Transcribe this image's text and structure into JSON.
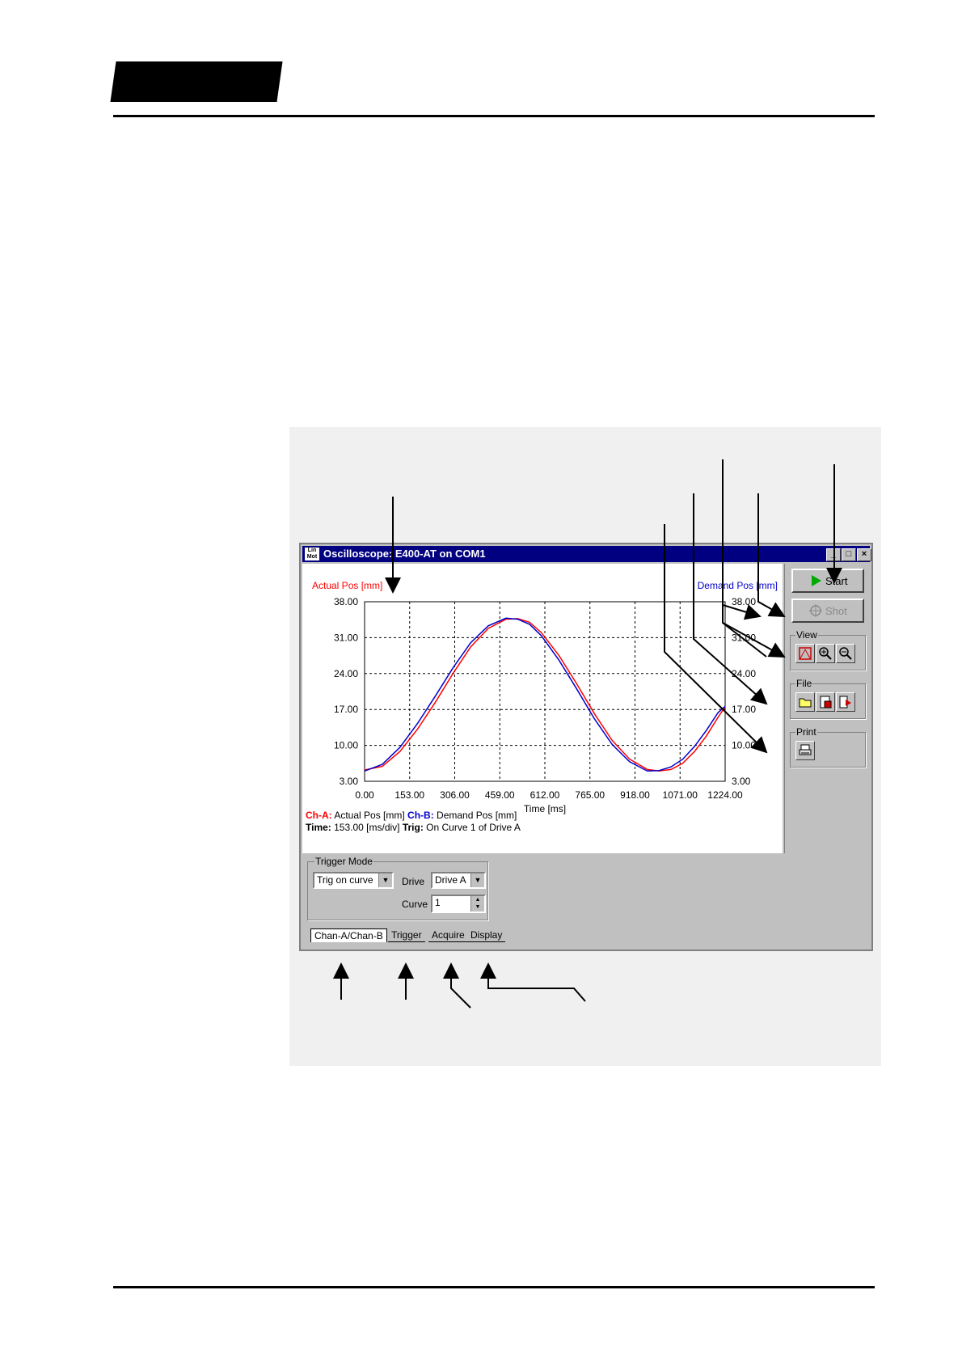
{
  "window": {
    "title": "Oscilloscope: E400-AT on COM1",
    "app_icon_line1": "Lin",
    "app_icon_line2": "Mot",
    "minimize_glyph": "_",
    "maximize_glyph": "□",
    "close_glyph": "×"
  },
  "side_panel": {
    "start_label": "Start",
    "shot_label": "Shot",
    "view_label": "View",
    "file_label": "File",
    "print_label": "Print"
  },
  "info": {
    "cha_label": "Ch-A:",
    "cha_value": "Actual Pos [mm]",
    "chb_label": "Ch-B:",
    "chb_value": "Demand Pos [mm]",
    "time_label": "Time:",
    "time_value": "153.00 [ms/div]",
    "trig_label": "Trig:",
    "trig_value": "On Curve 1 of Drive A"
  },
  "trigger": {
    "group_label": "Trigger Mode",
    "mode_value": "Trig on curve",
    "drive_label": "Drive",
    "drive_value": "Drive A",
    "curve_label": "Curve",
    "curve_value": "1"
  },
  "tabs": [
    "Chan-A/Chan-B",
    "Trigger",
    "Acquire",
    "Display"
  ],
  "colors": {
    "channel_a": "#ff0000",
    "channel_b": "#0000cc",
    "title_bar": "#000080",
    "start_icon": "#00aa00"
  },
  "chart_data": {
    "type": "line",
    "ylabel_left": "Actual Pos [mm]",
    "ylabel_right": "Demand Pos [mm]",
    "xlabel": "Time [ms]",
    "xlim": [
      0,
      1224
    ],
    "ylim": [
      3,
      38
    ],
    "x_ticks": [
      "0.00",
      "153.00",
      "306.00",
      "459.00",
      "612.00",
      "765.00",
      "918.00",
      "1071.00",
      "1224.00"
    ],
    "y_ticks": [
      "38.00",
      "31.00",
      "24.00",
      "17.00",
      "10.00",
      "3.00"
    ],
    "grid": true,
    "series": [
      {
        "name": "Actual Pos [mm]",
        "color": "#ff0000",
        "x": [
          0,
          60,
          120,
          180,
          240,
          300,
          360,
          420,
          480,
          520,
          560,
          600,
          660,
          720,
          780,
          840,
          900,
          960,
          1000,
          1040,
          1080,
          1120,
          1160,
          1200,
          1224
        ],
        "y": [
          5.2,
          5.9,
          8.8,
          13.2,
          18.4,
          24.0,
          29.2,
          32.8,
          34.6,
          34.7,
          34.0,
          32.0,
          27.5,
          22.0,
          16.2,
          11.0,
          7.3,
          5.3,
          5.0,
          5.3,
          6.5,
          8.8,
          11.8,
          15.5,
          17.5
        ]
      },
      {
        "name": "Demand Pos [mm]",
        "color": "#0000cc",
        "x": [
          0,
          60,
          120,
          180,
          240,
          300,
          360,
          420,
          480,
          520,
          560,
          600,
          660,
          720,
          780,
          840,
          900,
          960,
          1000,
          1040,
          1080,
          1120,
          1160,
          1200,
          1224
        ],
        "y": [
          5.0,
          6.3,
          9.6,
          14.3,
          19.6,
          25.1,
          30.0,
          33.3,
          34.8,
          34.6,
          33.6,
          31.4,
          26.6,
          21.0,
          15.2,
          10.2,
          6.8,
          5.0,
          5.1,
          5.8,
          7.3,
          9.8,
          12.9,
          16.4,
          17.6
        ]
      }
    ]
  }
}
